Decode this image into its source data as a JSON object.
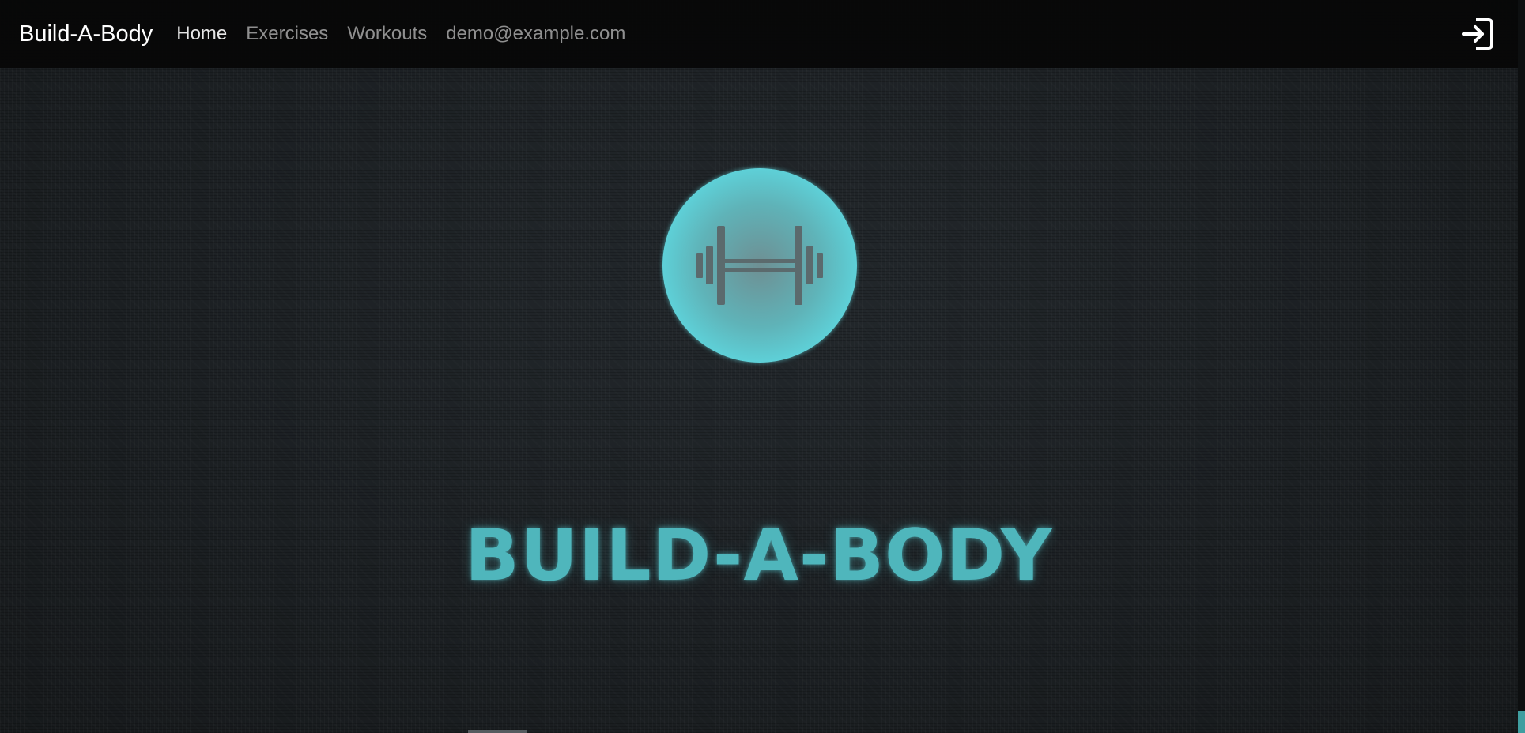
{
  "navbar": {
    "brand": "Build-A-Body",
    "links": [
      {
        "label": "Home",
        "active": true
      },
      {
        "label": "Exercises",
        "active": false
      },
      {
        "label": "Workouts",
        "active": false
      }
    ],
    "user_email": "demo@example.com",
    "logout_icon": "logout-icon"
  },
  "hero": {
    "logo_icon": "dumbbell-icon",
    "title": "BUILD-A-BODY"
  },
  "colors": {
    "accent": "#5ed5dd",
    "title": "#4fb6bc",
    "navbar_bg": "#060606",
    "page_bg": "#1a1d20"
  }
}
